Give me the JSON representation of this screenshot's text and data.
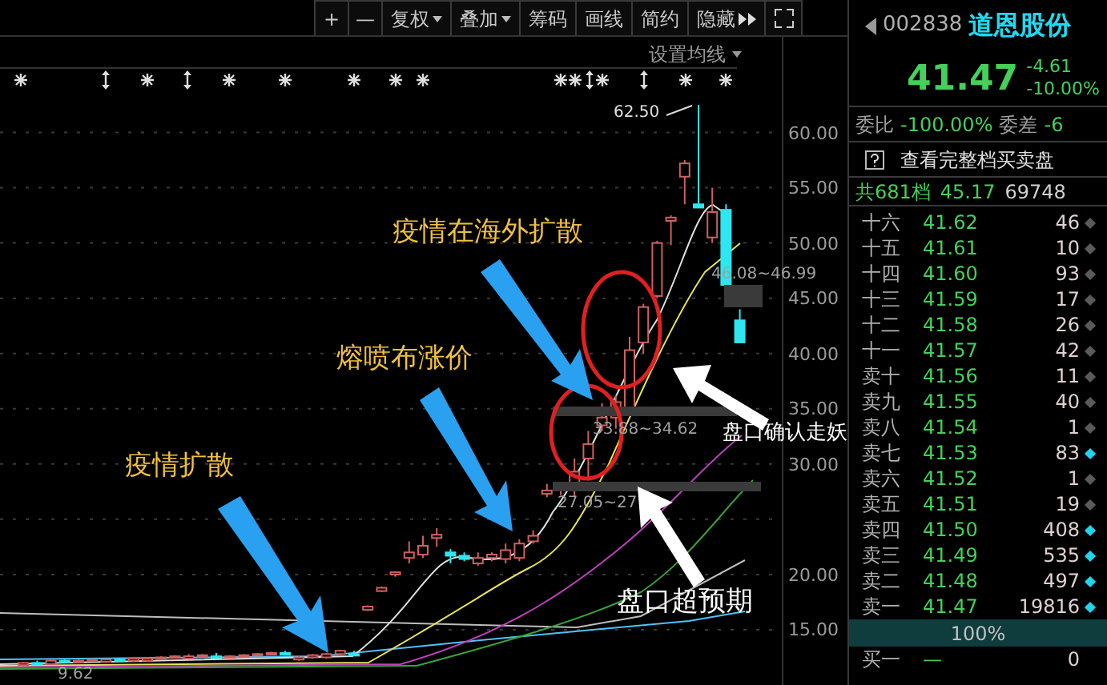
{
  "toolbar": {
    "buttons": [
      {
        "label": "+",
        "kind": "plain"
      },
      {
        "label": "—",
        "kind": "plain"
      },
      {
        "label": "复权",
        "kind": "dropdown"
      },
      {
        "label": "叠加",
        "kind": "dropdown"
      },
      {
        "label": "筹码",
        "kind": "plain"
      },
      {
        "label": "画线",
        "kind": "plain"
      },
      {
        "label": "简约",
        "kind": "plain"
      },
      {
        "label": "隐藏",
        "kind": "expand"
      }
    ]
  },
  "ma_setting": {
    "label": "设置均线"
  },
  "chart_data": {
    "type": "candlestick",
    "ohlc": [
      [
        11.8,
        12.1,
        11.6,
        12
      ],
      [
        12,
        12.2,
        11.8,
        11.9
      ],
      [
        11.9,
        12.3,
        11.8,
        12.2
      ],
      [
        12.2,
        12.3,
        12,
        12.1
      ],
      [
        12.1,
        12.3,
        12,
        12.2
      ],
      [
        12.2,
        12.4,
        12.1,
        12.3
      ],
      [
        12.1,
        12.4,
        12,
        12.3
      ],
      [
        12.3,
        12.4,
        12.1,
        12.2
      ],
      [
        12.2,
        12.5,
        12.1,
        12.4
      ],
      [
        12.2,
        12.5,
        12.1,
        12.4
      ],
      [
        12.4,
        12.6,
        12.3,
        12.5
      ],
      [
        12.5,
        12.7,
        12.4,
        12.6
      ],
      [
        12.4,
        12.8,
        12.3,
        12.6
      ],
      [
        12.6,
        12.8,
        12.5,
        12.7
      ],
      [
        12.6,
        12.9,
        12.5,
        12.5
      ],
      [
        12.5,
        12.7,
        12.4,
        12.6
      ],
      [
        12.6,
        12.8,
        12.5,
        12.7
      ],
      [
        12.7,
        12.9,
        12.6,
        12.8
      ],
      [
        12.8,
        13,
        12.7,
        12.9
      ],
      [
        12.9,
        13.1,
        12.7,
        12.8
      ],
      [
        12.3,
        12.6,
        12.2,
        12.5
      ],
      [
        12.5,
        12.8,
        12.4,
        12.7
      ],
      [
        12.5,
        12.9,
        12.4,
        12.8
      ],
      [
        12.8,
        13.2,
        12.7,
        13.1
      ],
      [
        12.8,
        13.1,
        12.7,
        12.7
      ],
      [
        16.8,
        17.2,
        16.7,
        17.1
      ],
      [
        18.5,
        18.9,
        18.4,
        18.8
      ],
      [
        20,
        20.3,
        19.8,
        20.2
      ],
      [
        21.5,
        23,
        21,
        22
      ],
      [
        21.8,
        23.5,
        21.5,
        22.6
      ],
      [
        23.3,
        24.2,
        22.5,
        23.6
      ],
      [
        22,
        22.3,
        21,
        21.7
      ],
      [
        21.7,
        22,
        21.2,
        21.4
      ],
      [
        21,
        22,
        20.8,
        21.5
      ],
      [
        21.5,
        22,
        21.2,
        21.8
      ],
      [
        21.4,
        22.8,
        21,
        22.2
      ],
      [
        21.5,
        23.2,
        21.2,
        22.8
      ],
      [
        23,
        24,
        22.8,
        23.5
      ],
      [
        27.3,
        28.2,
        27,
        27.6
      ],
      [
        27.6,
        28,
        27.2,
        27.8
      ],
      [
        28.2,
        30.5,
        27,
        29.3
      ],
      [
        30.5,
        33,
        28.5,
        31.8
      ],
      [
        33.5,
        35.5,
        33,
        34.2
      ],
      [
        34.2,
        36.2,
        33.2,
        35.6
      ],
      [
        35,
        41.5,
        34.8,
        40.3
      ],
      [
        41,
        44.5,
        40,
        44.2
      ],
      [
        45.2,
        50.2,
        45,
        50
      ],
      [
        52,
        52.5,
        49.8,
        52.3
      ],
      [
        56,
        57.5,
        53.5,
        57.2
      ],
      [
        53.5,
        62.5,
        53.2,
        53.2
      ],
      [
        50.5,
        55,
        50,
        52.8
      ],
      [
        53,
        53.5,
        46,
        46.2
      ],
      [
        43,
        44,
        41,
        41
      ]
    ],
    "ylim": [
      10,
      68.8
    ],
    "yticks": [
      {
        "value": 60,
        "label": "60.00"
      },
      {
        "value": 55,
        "label": "55.00"
      },
      {
        "value": 50,
        "label": "50.00"
      },
      {
        "value": 45,
        "label": "45.00"
      },
      {
        "value": 40,
        "label": "40.00"
      },
      {
        "value": 35,
        "label": "35.00"
      },
      {
        "value": 30,
        "label": "30.00"
      },
      {
        "value": 20,
        "label": "20.00"
      },
      {
        "value": 15,
        "label": "15.00"
      }
    ]
  },
  "chart_labels": [
    {
      "text": "62.50",
      "kind": "high"
    },
    {
      "text": "46.08~46.99",
      "kind": "range"
    },
    {
      "text": "33.88~34.62",
      "kind": "range"
    },
    {
      "text": "27.05~27",
      "kind": "range"
    },
    {
      "text": "9.62",
      "kind": "low"
    }
  ],
  "annotations": [
    {
      "text": "疫情扩散",
      "color": "#f0c040"
    },
    {
      "text": "熔喷布涨价",
      "color": "#f0c040"
    },
    {
      "text": "疫情在海外扩散",
      "color": "#f0c040"
    },
    {
      "text": "盘口确认走妖",
      "color": "#ffffff"
    },
    {
      "text": "盘口超预期",
      "color": "#ffffff"
    }
  ],
  "quote": {
    "code": "002838",
    "name": "道恩股份",
    "price": "41.47",
    "change": "-4.61",
    "change_pct": "-10.00%",
    "ratio_label": "委比",
    "ratio": "-100.00%",
    "diff_label": "委差",
    "diff": "-6",
    "full_book": "查看完整档买卖盘",
    "summary_label": "共681档",
    "summary_price": "45.17",
    "summary_volume": "69748"
  },
  "asks": [
    {
      "label": "十六",
      "price": "41.62",
      "volume": "46",
      "color": "#5a5a5a"
    },
    {
      "label": "十五",
      "price": "41.61",
      "volume": "10",
      "color": "#5a5a5a"
    },
    {
      "label": "十四",
      "price": "41.60",
      "volume": "93",
      "color": "#5a5a5a"
    },
    {
      "label": "十三",
      "price": "41.59",
      "volume": "17",
      "color": "#5a5a5a"
    },
    {
      "label": "十二",
      "price": "41.58",
      "volume": "26",
      "color": "#5a5a5a"
    },
    {
      "label": "十一",
      "price": "41.57",
      "volume": "42",
      "color": "#5a5a5a"
    },
    {
      "label": "卖十",
      "price": "41.56",
      "volume": "11",
      "color": "#5a5a5a"
    },
    {
      "label": "卖九",
      "price": "41.55",
      "volume": "40",
      "color": "#5a5a5a"
    },
    {
      "label": "卖八",
      "price": "41.54",
      "volume": "1",
      "color": "#5a5a5a"
    },
    {
      "label": "卖七",
      "price": "41.53",
      "volume": "83",
      "color": "#22d3ee"
    },
    {
      "label": "卖六",
      "price": "41.52",
      "volume": "1",
      "color": "#5a5a5a"
    },
    {
      "label": "卖五",
      "price": "41.51",
      "volume": "19",
      "color": "#5a5a5a"
    },
    {
      "label": "卖四",
      "price": "41.50",
      "volume": "408",
      "color": "#22d3ee"
    },
    {
      "label": "卖三",
      "price": "41.49",
      "volume": "535",
      "color": "#22d3ee"
    },
    {
      "label": "卖二",
      "price": "41.48",
      "volume": "497",
      "color": "#22d3ee"
    },
    {
      "label": "卖一",
      "price": "41.47",
      "volume": "19816",
      "color": "#22d3ee"
    }
  ],
  "ratio_bar": {
    "text": "100%",
    "level": 1
  },
  "bids": [
    {
      "label": "买一",
      "price": "—",
      "volume": "0"
    }
  ]
}
